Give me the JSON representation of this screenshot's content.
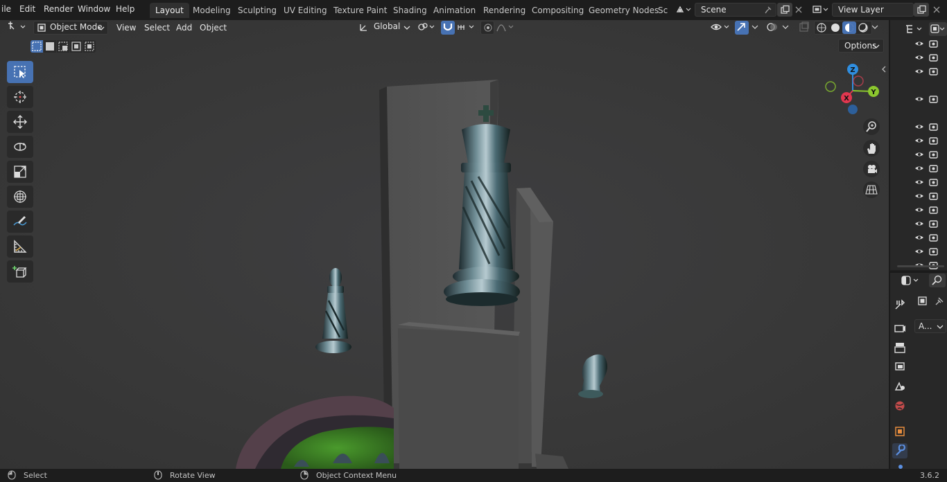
{
  "menubar": {
    "items": [
      "ile",
      "Edit",
      "Render",
      "Window",
      "Help"
    ]
  },
  "workspaces": {
    "tabs": [
      "Layout",
      "Modeling",
      "Sculpting",
      "UV Editing",
      "Texture Paint",
      "Shading",
      "Animation",
      "Rendering",
      "Compositing",
      "Geometry Nodes",
      "Sc"
    ],
    "active": "Layout"
  },
  "scene": {
    "name": "Scene"
  },
  "view_layer": {
    "name": "View Layer"
  },
  "viewport_header": {
    "mode": "Object Mode",
    "menus": [
      "View",
      "Select",
      "Add",
      "Object"
    ],
    "transform_orientation": "Global",
    "options_label": "Options"
  },
  "gizmo": {
    "x": "X",
    "y": "Y",
    "z": "Z"
  },
  "properties": {
    "field_label": "A..."
  },
  "statusbar": {
    "select": "Select",
    "rotate": "Rotate View",
    "context": "Object Context Menu",
    "version": "3.6.2"
  },
  "colors": {
    "accent": "#4772b3",
    "x_axis": "#e0374f",
    "y_axis": "#8bc72e",
    "z_axis": "#2f8ee0"
  }
}
